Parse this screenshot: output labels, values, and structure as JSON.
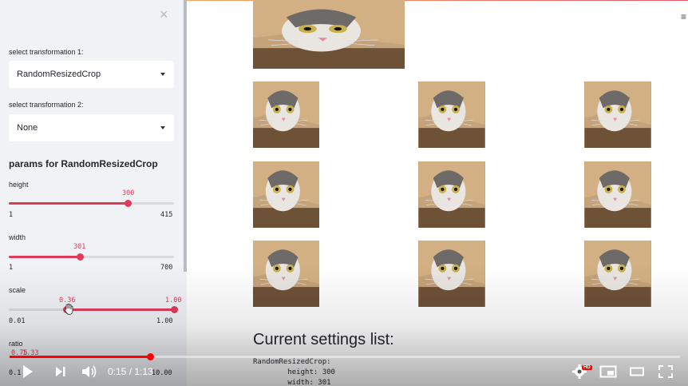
{
  "sidebar": {
    "close_glyph": "×",
    "transform1_label": "select transformation 1:",
    "transform1_value": "RandomResizedCrop",
    "transform2_label": "select transformation 2:",
    "transform2_value": "None",
    "params_title": "params for RandomResizedCrop",
    "height": {
      "label": "height",
      "value": "300",
      "min": "1",
      "max": "415",
      "fraction": 0.72
    },
    "width": {
      "label": "width",
      "value": "301",
      "min": "1",
      "max": "700",
      "fraction": 0.43
    },
    "scale": {
      "label": "scale",
      "value_low": "0.36",
      "value_high": "1.00",
      "min": "0.01",
      "max": "1.00"
    },
    "ratio": {
      "label": "ratio",
      "value": "0.75",
      "value2": "1.33",
      "min": "0.1",
      "max": "10.00"
    }
  },
  "main": {
    "settings_title": "Current settings list:",
    "code_lines": [
      "RandomResizedCrop:",
      "        height: 300",
      "        width: 301"
    ],
    "menu_glyph": "≡"
  },
  "player": {
    "current_time": "0:15",
    "duration": "1:13",
    "time_display": "0:15 / 1:13",
    "progress_fraction": 0.21,
    "hd_badge": "HD",
    "accent": "#ff0000"
  },
  "colors": {
    "slider": "#e03b5a",
    "sidebar_bg": "#f0f2f6"
  }
}
